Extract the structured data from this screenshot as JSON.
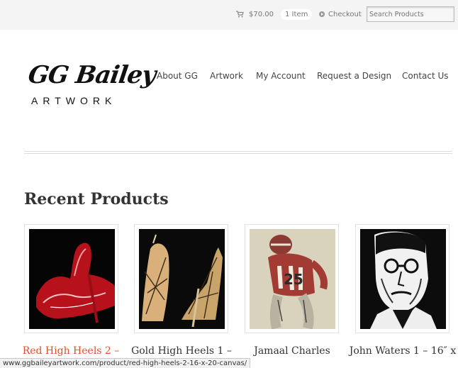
{
  "topbar": {
    "cart_total": "$70.00",
    "cart_count": "1 Item",
    "checkout_label": "Checkout",
    "search_placeholder": "Search Products"
  },
  "logo": {
    "script_text": "GG Bailey",
    "sub_text": "ARTWORK"
  },
  "nav": {
    "items": [
      {
        "label": "About GG"
      },
      {
        "label": "Artwork"
      },
      {
        "label": "My Account"
      },
      {
        "label": "Request a Design"
      },
      {
        "label": "Contact Us"
      }
    ]
  },
  "main": {
    "section_title": "Recent Products",
    "products": [
      {
        "title_line1": "Red High Heels 2 –",
        "title_line2": ""
      },
      {
        "title_line1": "Gold High Heels 1 –",
        "title_line2": ""
      },
      {
        "title_line1": "Jamaal Charles",
        "title_line2": ""
      },
      {
        "title_line1": "John Waters 1 – 16″ x",
        "title_line2": ""
      }
    ]
  },
  "statusbar": {
    "url": "www.ggbaileyartwork.com/product/red-high-heels-2-16-x-20-canvas/"
  },
  "colors": {
    "accent_link": "#e0502a",
    "topbar_bg": "#f4f4f4"
  },
  "icons": [
    "cart-icon",
    "checkout-icon"
  ]
}
